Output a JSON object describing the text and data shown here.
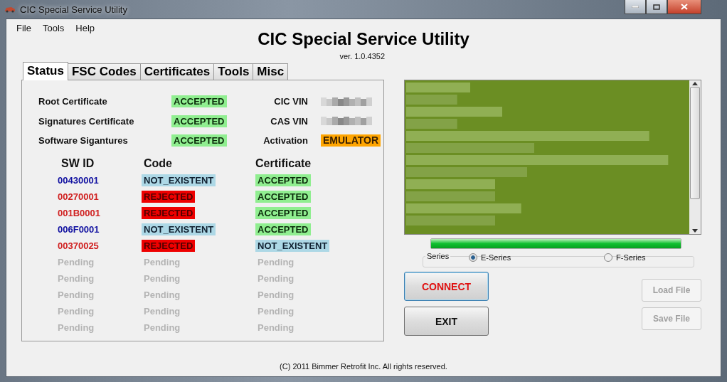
{
  "window": {
    "title": "CIC Special Service Utility"
  },
  "menu": [
    "File",
    "Tools",
    "Help"
  ],
  "header": {
    "title": "CIC Special Service Utility",
    "version": "ver. 1.0.4352"
  },
  "tabs": [
    {
      "label": "Status",
      "selected": true
    },
    {
      "label": "FSC Codes",
      "selected": false
    },
    {
      "label": "Certificates",
      "selected": false
    },
    {
      "label": "Tools",
      "selected": false
    },
    {
      "label": "Misc",
      "selected": false
    }
  ],
  "summary": [
    {
      "label": "Root Certificate",
      "status": {
        "text": "ACCEPTED",
        "kind": "accepted"
      },
      "field_label": "CIC VIN",
      "value": {
        "kind": "redacted"
      }
    },
    {
      "label": "Signatures Certificate",
      "status": {
        "text": "ACCEPTED",
        "kind": "accepted"
      },
      "field_label": "CAS VIN",
      "value": {
        "kind": "redacted"
      }
    },
    {
      "label": "Software Sigantures",
      "status": {
        "text": "ACCEPTED",
        "kind": "accepted"
      },
      "field_label": "Activation",
      "value": {
        "kind": "emulator",
        "text": "EMULATOR"
      }
    }
  ],
  "table": {
    "columns": [
      "SW ID",
      "Code",
      "Certificate"
    ],
    "rows": [
      {
        "sw_id": {
          "text": "00430001",
          "color": "#1010a0"
        },
        "code": {
          "text": "NOT_EXISTENT",
          "kind": "not_existent"
        },
        "certificate": {
          "text": "ACCEPTED",
          "kind": "accepted"
        }
      },
      {
        "sw_id": {
          "text": "00270001",
          "color": "#d02020"
        },
        "code": {
          "text": "REJECTED",
          "kind": "rejected"
        },
        "certificate": {
          "text": "ACCEPTED",
          "kind": "accepted"
        }
      },
      {
        "sw_id": {
          "text": "001B0001",
          "color": "#d02020"
        },
        "code": {
          "text": "REJECTED",
          "kind": "rejected"
        },
        "certificate": {
          "text": "ACCEPTED",
          "kind": "accepted"
        }
      },
      {
        "sw_id": {
          "text": "006F0001",
          "color": "#1010a0"
        },
        "code": {
          "text": "NOT_EXISTENT",
          "kind": "not_existent"
        },
        "certificate": {
          "text": "ACCEPTED",
          "kind": "accepted"
        }
      },
      {
        "sw_id": {
          "text": "00370025",
          "color": "#d02020"
        },
        "code": {
          "text": "REJECTED",
          "kind": "rejected"
        },
        "certificate": {
          "text": "NOT_EXISTENT",
          "kind": "not_existent"
        }
      },
      {
        "sw_id": {
          "text": "Pending",
          "color": "#b4b4b4"
        },
        "code": {
          "text": "Pending",
          "kind": "pending"
        },
        "certificate": {
          "text": "Pending",
          "kind": "pending"
        }
      },
      {
        "sw_id": {
          "text": "Pending",
          "color": "#b4b4b4"
        },
        "code": {
          "text": "Pending",
          "kind": "pending"
        },
        "certificate": {
          "text": "Pending",
          "kind": "pending"
        }
      },
      {
        "sw_id": {
          "text": "Pending",
          "color": "#b4b4b4"
        },
        "code": {
          "text": "Pending",
          "kind": "pending"
        },
        "certificate": {
          "text": "Pending",
          "kind": "pending"
        }
      },
      {
        "sw_id": {
          "text": "Pending",
          "color": "#b4b4b4"
        },
        "code": {
          "text": "Pending",
          "kind": "pending"
        },
        "certificate": {
          "text": "Pending",
          "kind": "pending"
        }
      },
      {
        "sw_id": {
          "text": "Pending",
          "color": "#b4b4b4"
        },
        "code": {
          "text": "Pending",
          "kind": "pending"
        },
        "certificate": {
          "text": "Pending",
          "kind": "pending"
        }
      }
    ]
  },
  "progress": {
    "level": 1
  },
  "series": {
    "label": "Series",
    "options": [
      {
        "label": "E-Series",
        "selected": true
      },
      {
        "label": "F-Series",
        "selected": false
      }
    ]
  },
  "main_buttons": [
    {
      "label": "CONNECT",
      "kind": "primary"
    },
    {
      "label": "EXIT",
      "kind": "default"
    }
  ],
  "file_buttons": [
    {
      "label": "Load File",
      "disabled": true
    },
    {
      "label": "Save File",
      "disabled": true
    }
  ],
  "footer": "(C) 2011 Bimmer Retrofit Inc. All rights reserved."
}
